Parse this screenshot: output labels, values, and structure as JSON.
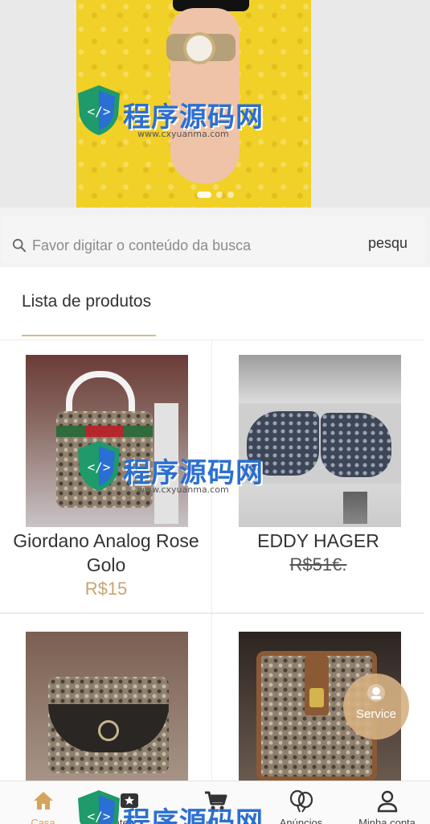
{
  "search": {
    "placeholder": "Favor digitar o conteúdo da busca",
    "button_label": "pesqu"
  },
  "section": {
    "title": "Lista de produtos"
  },
  "products": [
    {
      "name": "Giordano Analog Rose Golo",
      "price": "R$15"
    },
    {
      "name": "EDDY HAGER",
      "price": "R$51€."
    },
    {
      "name": "",
      "price": ""
    },
    {
      "name": "",
      "price": ""
    }
  ],
  "service": {
    "label": "Service"
  },
  "bottom_nav": {
    "items": [
      {
        "label": "Casa",
        "icon": "home-icon",
        "active": true
      },
      {
        "label": "Categoria",
        "icon": "category-icon",
        "active": false
      },
      {
        "label": "Carrinho",
        "icon": "cart-icon",
        "active": false
      },
      {
        "label": "Anúncios",
        "icon": "balloon-icon",
        "active": false
      },
      {
        "label": "Minha conta",
        "icon": "user-icon",
        "active": false
      }
    ]
  },
  "watermark": {
    "text": "程序源码网",
    "url": "www.cxyuanma.com"
  },
  "colors": {
    "accent": "#d5a45a",
    "price": "#c8a56e",
    "banner_yellow": "#f1d027"
  }
}
